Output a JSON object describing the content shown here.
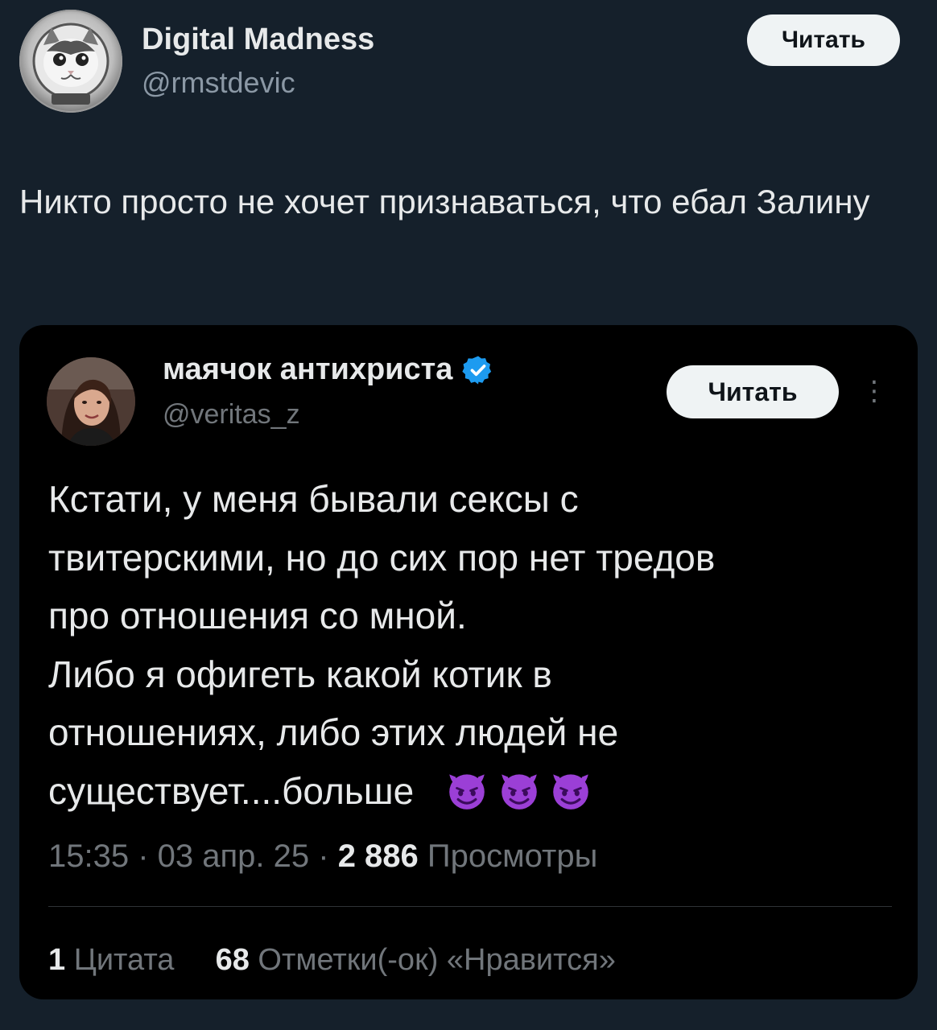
{
  "main_tweet": {
    "author_name": "Digital Madness",
    "author_handle": "@rmstdevic",
    "follow_label": "Читать",
    "text": "Никто просто не хочет признаваться, что ебал Залину"
  },
  "quoted_tweet": {
    "author_name": "маячок антихриста",
    "author_handle": "@veritas_z",
    "follow_label": "Читать",
    "more_label": "⋮",
    "text_lines": [
      "Кстати, у меня бывали сексы с",
      "твитерскими, но до сих пор нет тредов",
      "про отношения со мной.",
      "Либо я офигеть какой котик в",
      "отношениях, либо этих людей не",
      "существует....больше"
    ],
    "emoji": [
      "smiling-devil-icon",
      "smiling-devil-icon",
      "smiling-devil-icon"
    ],
    "time": "15:35",
    "date": "03 апр. 25",
    "separator": " · ",
    "views_count": "2 886",
    "views_label": "Просмотры",
    "quotes_count": "1",
    "quotes_label": "Цитата",
    "likes_count": "68",
    "likes_label": "Отметки(-ок) «Нравится»"
  },
  "colors": {
    "outer_background": "#15202b",
    "card_background": "#000000",
    "primary_text": "#e7e9ea",
    "secondary_text": "#8b98a5",
    "verified_badge": "#1d9bf0",
    "devil_purple": "#9b3fd6"
  }
}
